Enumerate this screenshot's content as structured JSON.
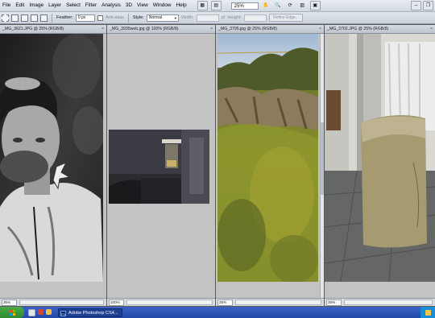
{
  "menu": {
    "items": [
      "File",
      "Edit",
      "Image",
      "Layer",
      "Select",
      "Filter",
      "Analysis",
      "3D",
      "View",
      "Window",
      "Help"
    ],
    "zoom_select": "25%",
    "app_icons": [
      "hand-icon",
      "zoom-icon",
      "rotate-icon",
      "arrange-icon",
      "screen-mode-icon"
    ]
  },
  "options": {
    "feather_label": "Feather:",
    "feather_value": "0 px",
    "antialias_label": "Anti-alias",
    "style_label": "Style:",
    "style_value": "Normal",
    "width_label": "Width:",
    "height_label": "Height:",
    "refine_edge": "Refine Edge..."
  },
  "documents": [
    {
      "tab": "_MG_3621.JPG @ 25% (RGB/8)",
      "zoom": "25%"
    },
    {
      "tab": "_MG_3935web.jpg @ 100% (RGB/8)",
      "zoom": "100%"
    },
    {
      "tab": "_MG_3795.jpg @ 25% (RGB/8)",
      "zoom": "25%"
    },
    {
      "tab": "_MG_3702.JPG @ 25% (RGB/8)",
      "zoom": "25%"
    }
  ],
  "taskbar": {
    "photoshop_task": "Adobe Photoshop CS4...",
    "photoshop_icon": "Ps"
  },
  "colors": {
    "taskbar_blue": "#2a52b8",
    "start_green": "#3a9a38",
    "canvas_gray": "#c0c0c0"
  }
}
